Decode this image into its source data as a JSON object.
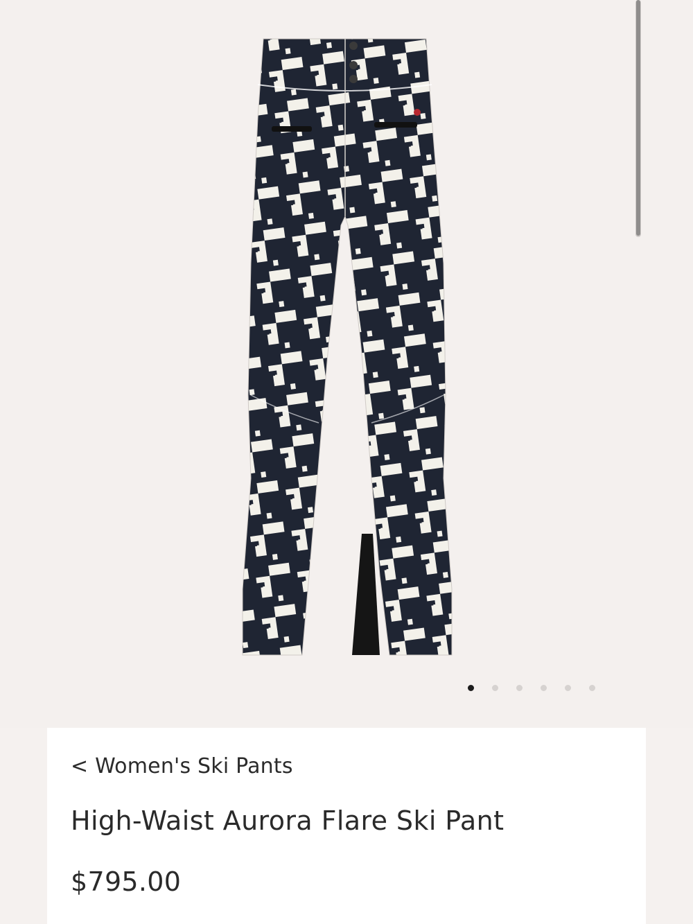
{
  "gallery": {
    "image_name": "high-waist-aurora-flare-ski-pant-houndstooth",
    "slide_count": 6,
    "active_slide": 0
  },
  "details": {
    "back_link": "< Women's Ski Pants",
    "title": "High-Waist Aurora Flare Ski Pant",
    "price": "$795.00"
  },
  "colors": {
    "background": "#f4f0ee",
    "panel": "#ffffff",
    "text": "#2a2a2a",
    "pattern_dark": "#1f2533",
    "pattern_light": "#f3f1ea",
    "dot_active": "#1c1c1c",
    "dot_inactive": "#d6d2d0"
  }
}
